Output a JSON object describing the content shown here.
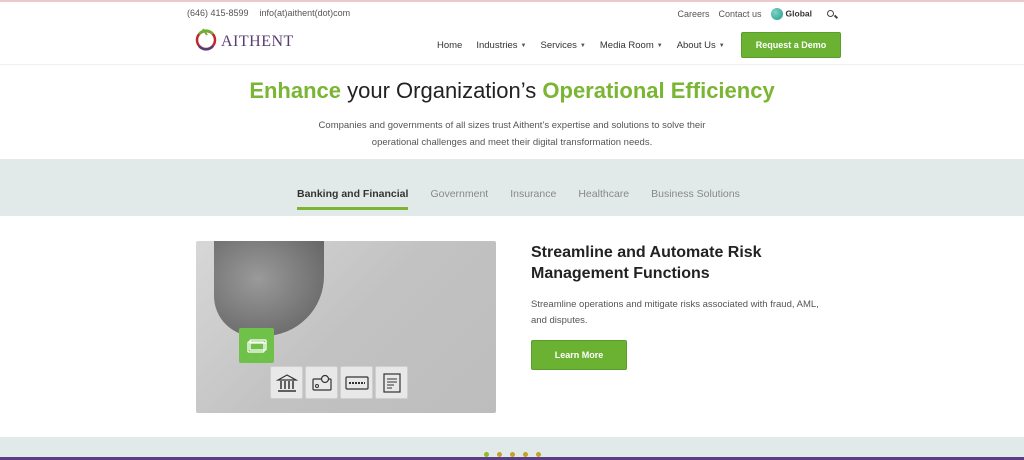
{
  "utility": {
    "phone": "(646) 415-8599",
    "email": "info(at)aithent(dot)com",
    "careers": "Careers",
    "contact": "Contact us",
    "global": "Global"
  },
  "brand": {
    "name": "AITHENT"
  },
  "nav": {
    "items": [
      {
        "label": "Home",
        "has_dropdown": false
      },
      {
        "label": "Industries",
        "has_dropdown": true
      },
      {
        "label": "Services",
        "has_dropdown": true
      },
      {
        "label": "Media Room",
        "has_dropdown": true
      },
      {
        "label": "About Us",
        "has_dropdown": true
      }
    ],
    "cta": "Request a Demo"
  },
  "hero": {
    "title_part1": "Enhance",
    "title_part2": " your Organization’s ",
    "title_part3": "Operational Efficiency",
    "subtitle": "Companies and governments of all sizes trust Aithent’s expertise and solutions to solve their operational challenges and meet their digital transformation needs."
  },
  "tabs": [
    {
      "label": "Banking and Financial",
      "active": true
    },
    {
      "label": "Government",
      "active": false
    },
    {
      "label": "Insurance",
      "active": false
    },
    {
      "label": "Healthcare",
      "active": false
    },
    {
      "label": "Business Solutions",
      "active": false
    }
  ],
  "content": {
    "title": "Streamline and Automate Risk Management Functions",
    "description": "Streamline operations and mitigate risks associated with fraud, AML, and disputes.",
    "button": "Learn More",
    "image_icons": [
      "bank-icon",
      "credit-card-badge-icon",
      "atm-card-icon",
      "invoice-icon"
    ]
  },
  "colors": {
    "accent_green": "#7ab533",
    "button_green": "#6bb232",
    "band": "#e2eae9",
    "brand_purple": "#5a3d6e"
  },
  "carousel": {
    "count": 5,
    "active_index": 0
  }
}
